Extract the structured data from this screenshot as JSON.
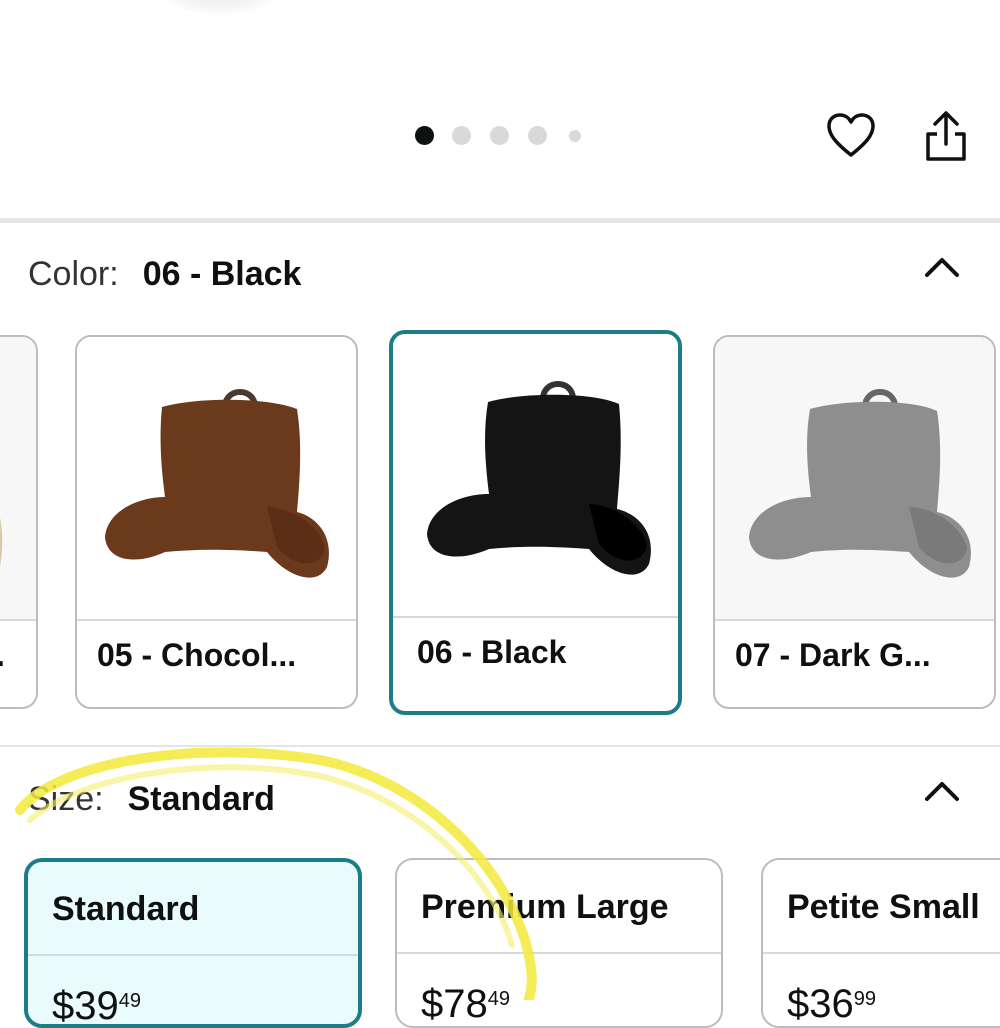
{
  "carousel": {
    "dot_count": 5,
    "active_index": 0
  },
  "actions": {
    "wishlist_icon": "heart-icon",
    "share_icon": "share-icon"
  },
  "color": {
    "label": "Color:",
    "value": "06 - Black",
    "collapse_icon": "chevron-up-icon",
    "options": [
      {
        "label": ".",
        "swatch": "#d9c9a8",
        "selected": false
      },
      {
        "label": "05 - Chocol...",
        "swatch": "#6b3a1c",
        "selected": false
      },
      {
        "label": "06 - Black",
        "swatch": "#141414",
        "selected": true
      },
      {
        "label": "07 - Dark G...",
        "swatch": "#8e8e8e",
        "selected": false
      }
    ]
  },
  "size": {
    "label": "Size:",
    "value": "Standard",
    "collapse_icon": "chevron-up-icon",
    "options": [
      {
        "name": "Standard",
        "price_whole": "$39",
        "price_fraction": "49",
        "selected": true
      },
      {
        "name": "Premium Large",
        "price_whole": "$78",
        "price_fraction": "49",
        "selected": false
      },
      {
        "name": "Petite Small",
        "price_whole": "$36",
        "price_fraction": "99",
        "selected": false
      }
    ]
  },
  "colors": {
    "accent": "#1a7d88",
    "selected_bg": "#eafbfd",
    "highlight": "#f2ea3a"
  }
}
